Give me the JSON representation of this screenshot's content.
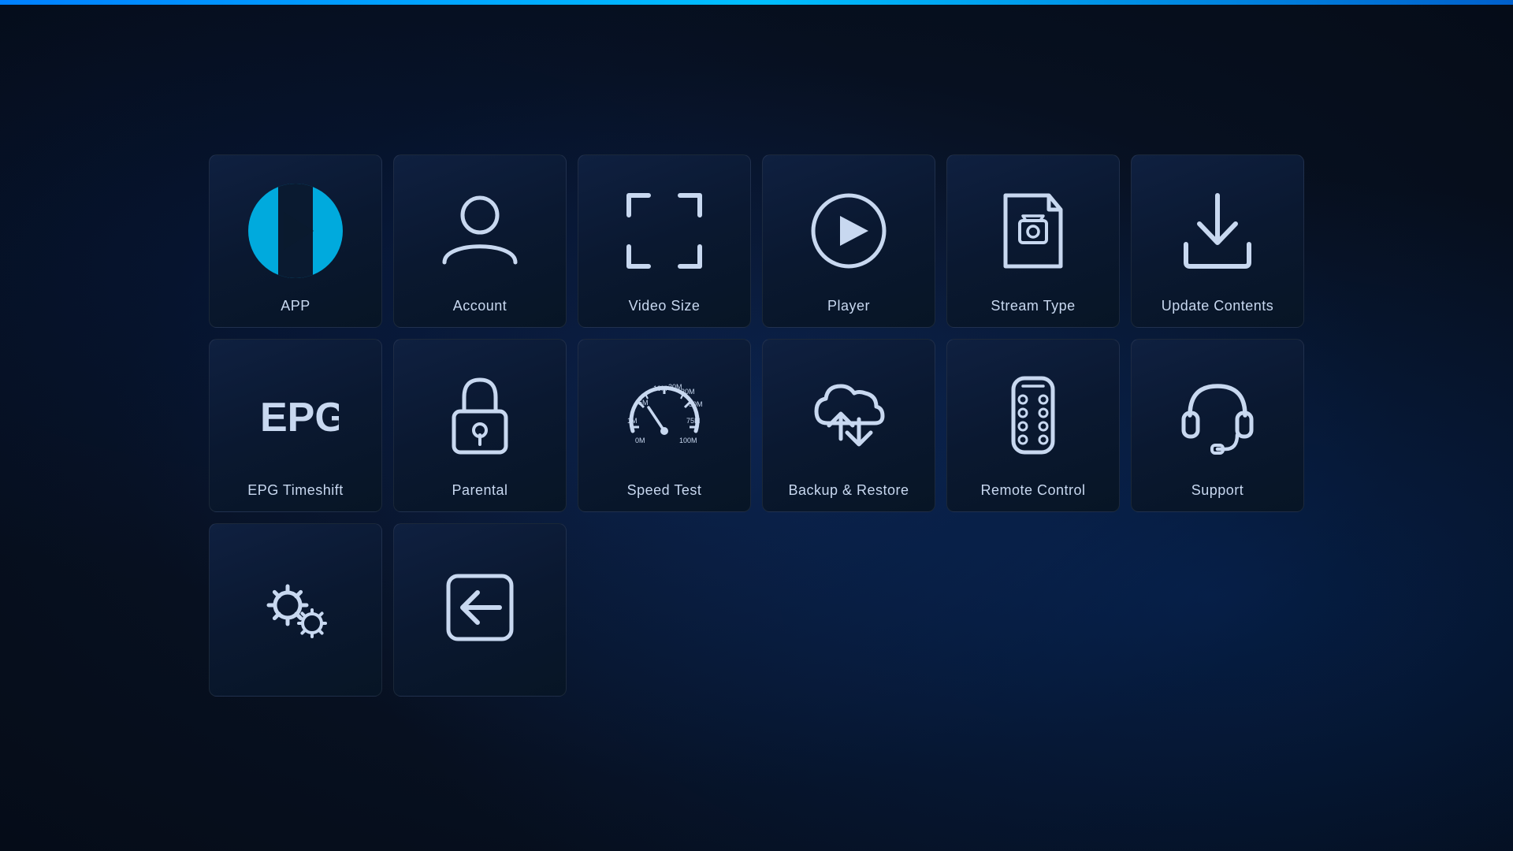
{
  "tiles": [
    {
      "id": "app",
      "label": "APP",
      "type": "app"
    },
    {
      "id": "account",
      "label": "Account",
      "type": "account"
    },
    {
      "id": "video-size",
      "label": "Video Size",
      "type": "video-size"
    },
    {
      "id": "player",
      "label": "Player",
      "type": "player"
    },
    {
      "id": "stream-type",
      "label": "Stream Type",
      "type": "stream-type"
    },
    {
      "id": "update-contents",
      "label": "Update Contents",
      "type": "update-contents"
    },
    {
      "id": "epg-timeshift",
      "label": "EPG Timeshift",
      "type": "epg-timeshift"
    },
    {
      "id": "parental",
      "label": "Parental",
      "type": "parental"
    },
    {
      "id": "speed-test",
      "label": "Speed Test",
      "type": "speed-test"
    },
    {
      "id": "backup-restore",
      "label": "Backup & Restore",
      "type": "backup-restore"
    },
    {
      "id": "remote-control",
      "label": "Remote Control",
      "type": "remote-control"
    },
    {
      "id": "support",
      "label": "Support",
      "type": "support"
    },
    {
      "id": "settings",
      "label": "",
      "type": "settings"
    },
    {
      "id": "exit",
      "label": "",
      "type": "exit"
    },
    {
      "id": "empty1",
      "label": "",
      "type": "empty"
    },
    {
      "id": "empty2",
      "label": "",
      "type": "empty"
    },
    {
      "id": "empty3",
      "label": "",
      "type": "empty"
    },
    {
      "id": "empty4",
      "label": "",
      "type": "empty"
    }
  ]
}
